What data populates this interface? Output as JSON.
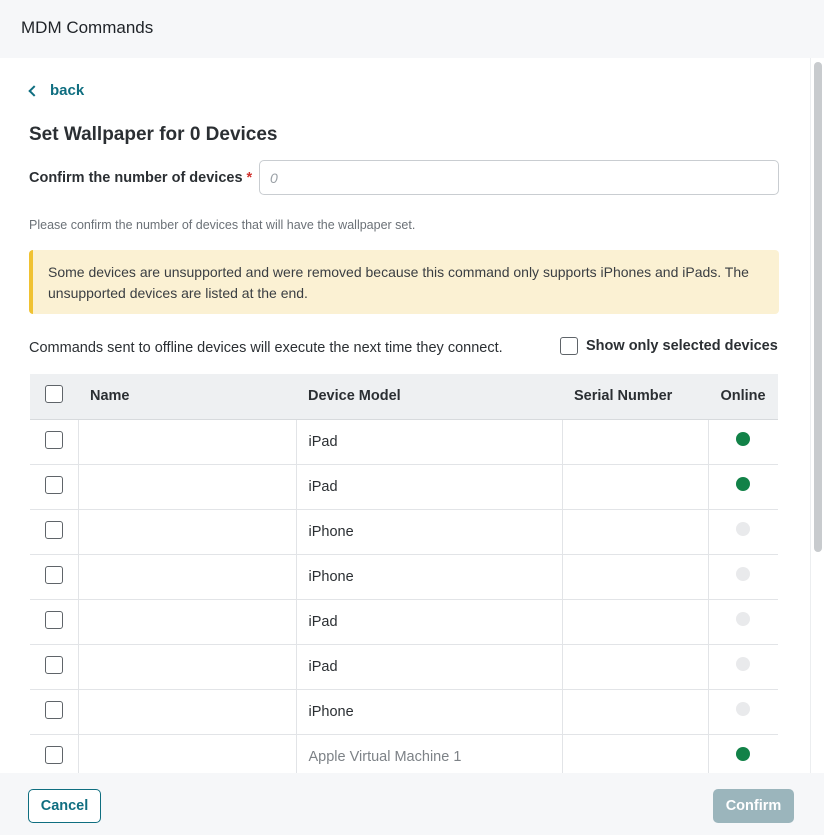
{
  "window": {
    "title": "MDM Commands"
  },
  "nav": {
    "back_label": "back"
  },
  "page": {
    "heading": "Set Wallpaper for 0 Devices"
  },
  "confirm": {
    "label": "Confirm the number of devices",
    "required_marker": "*",
    "placeholder": "0",
    "value": "",
    "helper": "Please confirm the number of devices that will have the wallpaper set."
  },
  "warning": {
    "text": "Some devices are unsupported and were removed because this command only supports iPhones and iPads. The unsupported devices are listed at the end."
  },
  "offline_note": "Commands sent to offline devices will execute the next time they connect.",
  "show_selected": {
    "label": "Show only selected devices",
    "checked": false
  },
  "table": {
    "columns": [
      "Name",
      "Device Model",
      "Serial Number",
      "Online"
    ],
    "rows": [
      {
        "name": "",
        "model": "iPad",
        "serial": "",
        "online": true
      },
      {
        "name": "",
        "model": "iPad",
        "serial": "",
        "online": true
      },
      {
        "name": "",
        "model": "iPhone",
        "serial": "",
        "online": false
      },
      {
        "name": "",
        "model": "iPhone",
        "serial": "",
        "online": false
      },
      {
        "name": "",
        "model": "iPad",
        "serial": "",
        "online": false
      },
      {
        "name": "",
        "model": "iPad",
        "serial": "",
        "online": false
      },
      {
        "name": "",
        "model": "iPhone",
        "serial": "",
        "online": false
      },
      {
        "name": "",
        "model": "Apple Virtual Machine 1",
        "serial": "",
        "online": true
      }
    ]
  },
  "footer": {
    "cancel_label": "Cancel",
    "confirm_label": "Confirm"
  },
  "colors": {
    "accent": "#0f6e80",
    "online": "#128248",
    "offline": "#e9eaec",
    "warning_bg": "#fbf1d3",
    "warning_border": "#f0c232",
    "confirm_disabled": "#9bb5bc"
  },
  "icons": {
    "back": "chevron-left-icon",
    "status": "status-dot-icon"
  }
}
